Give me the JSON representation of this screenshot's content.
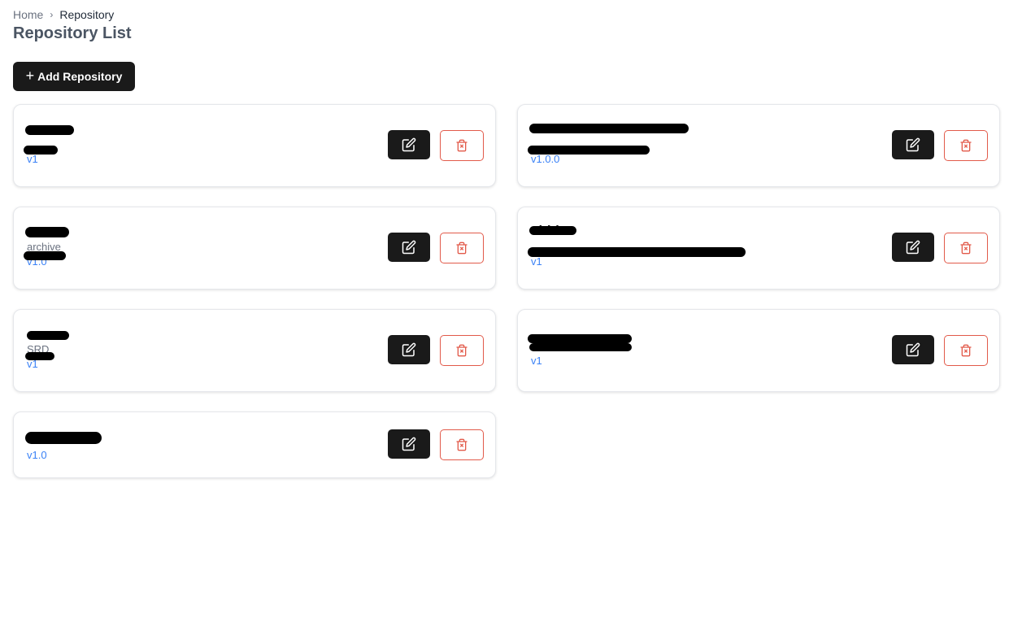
{
  "breadcrumb": {
    "home": "Home",
    "separator": "›",
    "current": "Repository"
  },
  "page_title": "Repository List",
  "add_button": {
    "label": "Add Repository",
    "icon": "plus-icon"
  },
  "repositories": [
    {
      "name": "",
      "description": "",
      "version": "v1"
    },
    {
      "name": "",
      "description": "",
      "version": "v1.0.0"
    },
    {
      "name": "",
      "description": "archive",
      "version": "v1.0"
    },
    {
      "name": "shida",
      "description": "",
      "version": "v1"
    },
    {
      "name": "",
      "description": "SRD",
      "version": "v1"
    },
    {
      "name": "",
      "description": "",
      "version": "v1"
    },
    {
      "name": "",
      "description": "",
      "version": "v1.0"
    }
  ],
  "icons": {
    "edit": "edit-icon",
    "delete": "delete-icon"
  },
  "colors": {
    "primary_button": "#1a1a1a",
    "danger": "#e25a4a",
    "version_text": "#3b82f6",
    "title": "#4b5563"
  }
}
